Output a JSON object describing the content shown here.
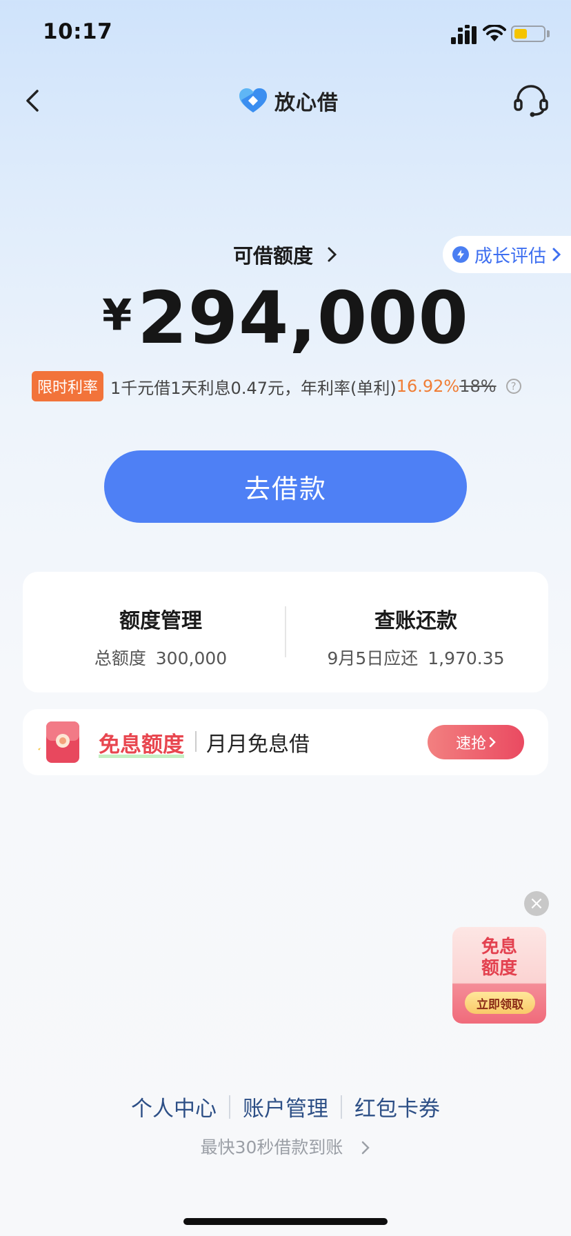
{
  "status": {
    "time": "10:17"
  },
  "nav": {
    "app_name": "放心借"
  },
  "credit": {
    "label": "可借额度",
    "currency": "¥",
    "amount": "294,000",
    "growth_button": "成长评估"
  },
  "rate": {
    "badge": "限时利率",
    "text": "1千元借1天利息0.47元，年利率(单利)",
    "current": "16.92%",
    "original": "18%"
  },
  "borrow_button": "去借款",
  "management": {
    "limit": {
      "title": "额度管理",
      "sub_label": "总额度",
      "sub_value": "300,000"
    },
    "repay": {
      "title": "查账还款",
      "sub_label": "9月5日应还",
      "sub_value": "1,970.35"
    }
  },
  "promo": {
    "title": "免息额度",
    "subtitle": "月月免息借",
    "button": "速抢"
  },
  "float_widget": {
    "title_line1": "免息",
    "title_line2": "额度",
    "button": "立即领取"
  },
  "footer": {
    "links": [
      "个人中心",
      "账户管理",
      "红包卡券"
    ],
    "note": "最快30秒借款到账"
  },
  "colors": {
    "primary": "#4e80f5",
    "accent_orange": "#f07d35",
    "promo_red": "#e8464f",
    "link_blue": "#2d4f86"
  }
}
